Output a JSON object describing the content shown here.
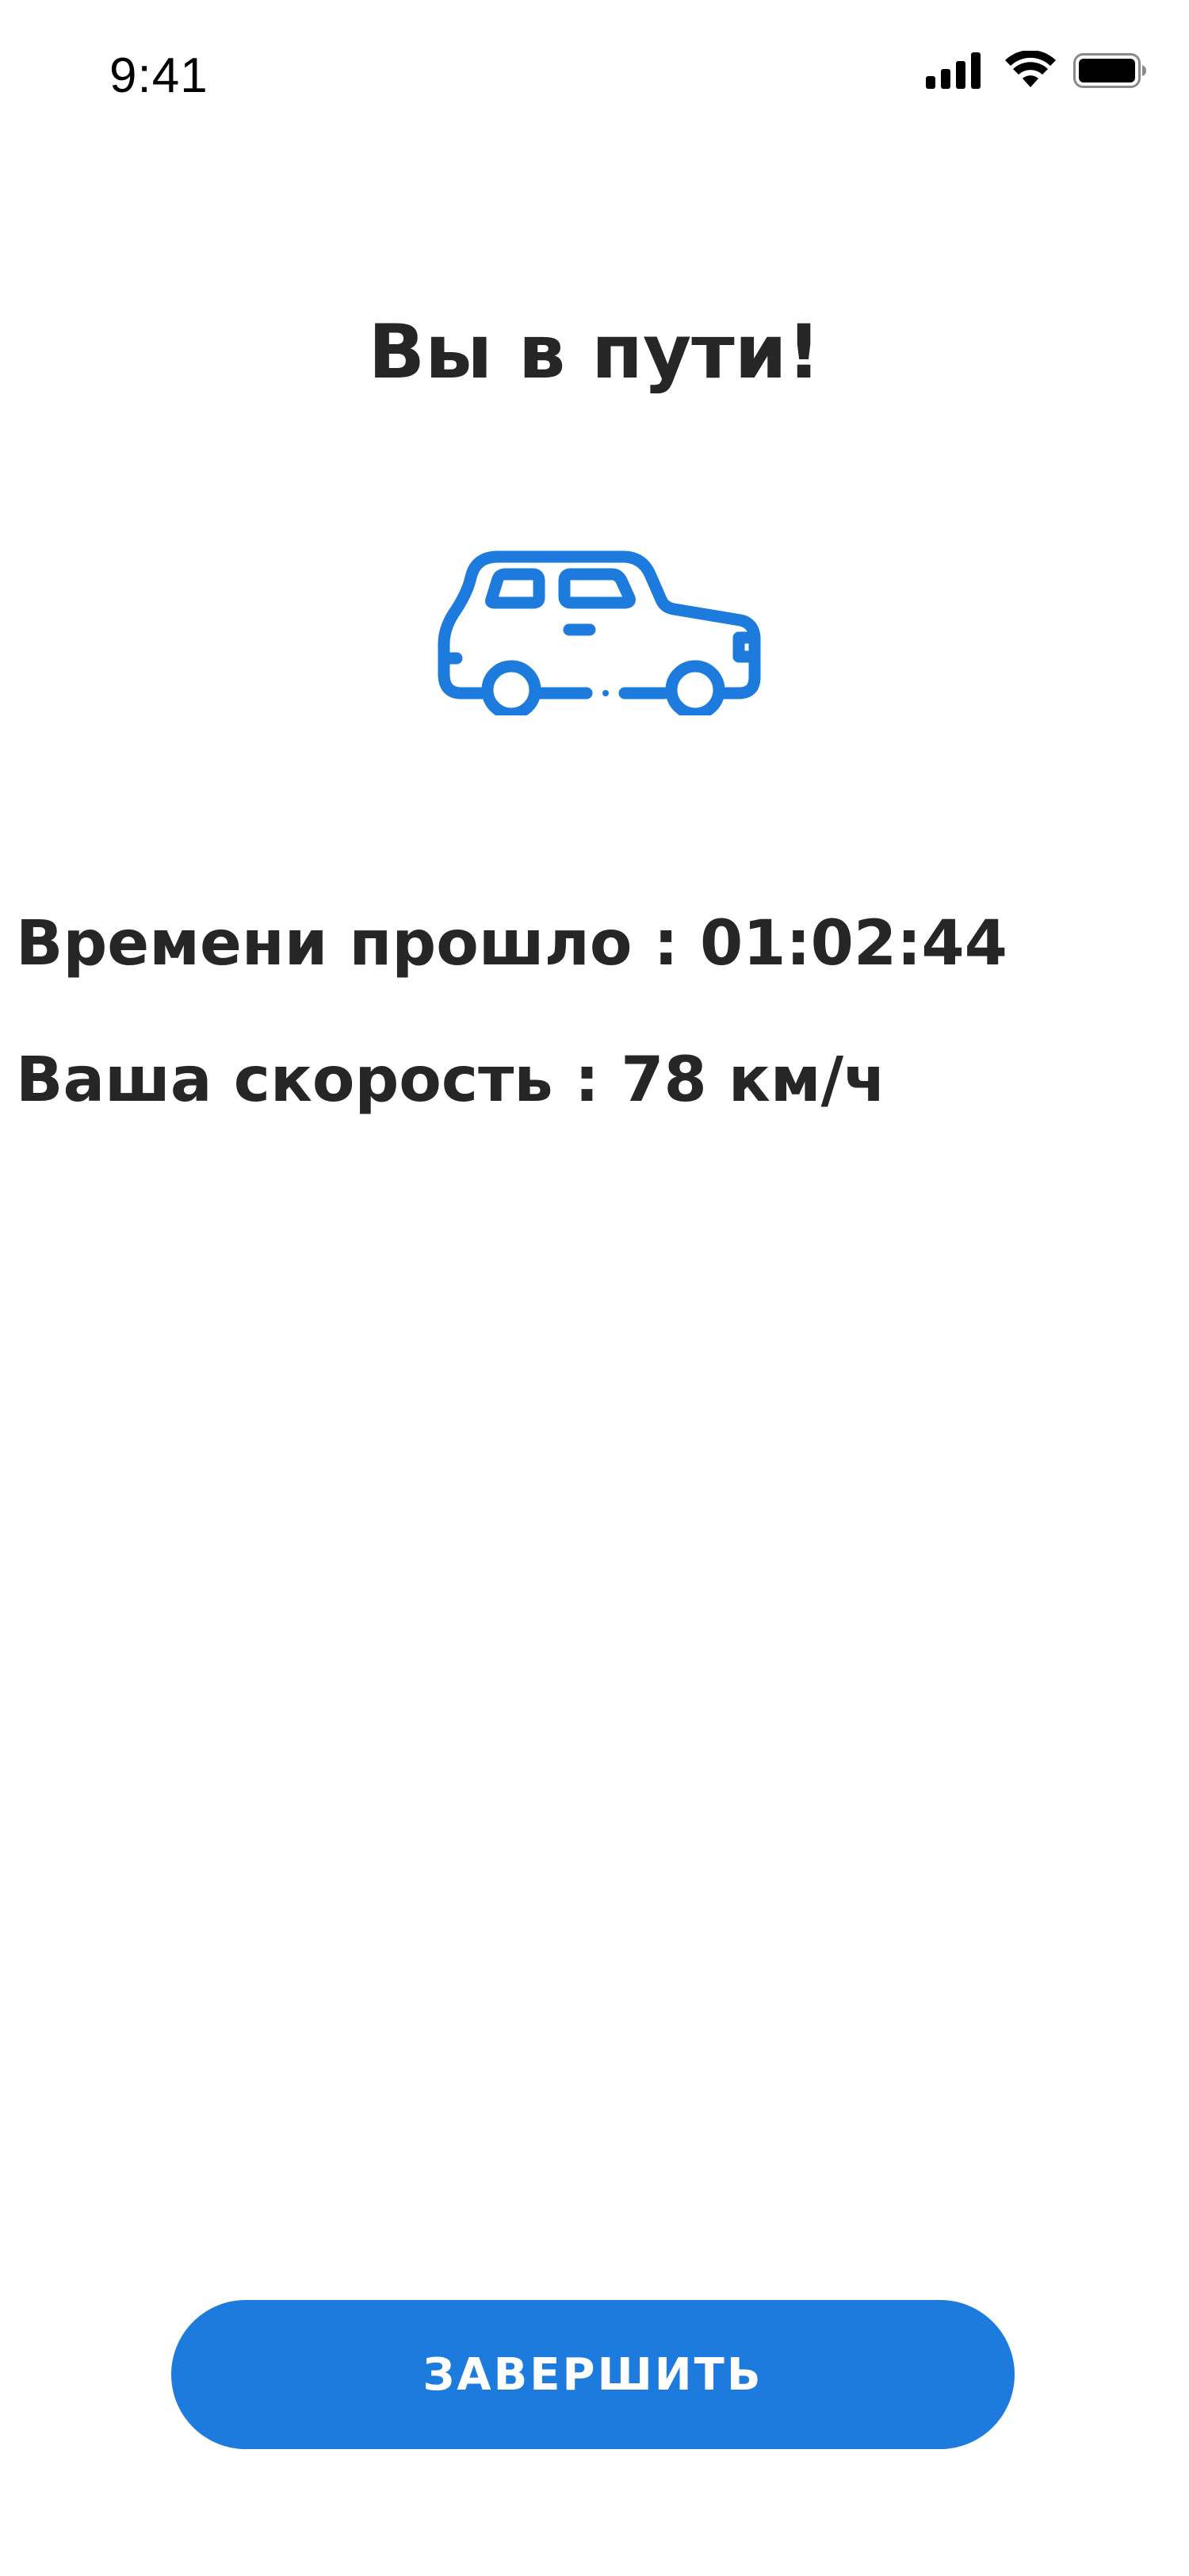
{
  "status_bar": {
    "time": "9:41",
    "icons": [
      "cellular-signal-icon",
      "wifi-icon",
      "battery-icon"
    ]
  },
  "title": "Вы в пути!",
  "illustration": {
    "icon": "car-icon",
    "color": "#1c7bdd"
  },
  "info": {
    "elapsed_label": "Времени прошло",
    "elapsed_value": "01:02:44",
    "speed_label": "Ваша скорость",
    "speed_value": "78 км/ч",
    "separator": " : "
  },
  "actions": {
    "finish_label": "ЗАВЕРШИТЬ"
  },
  "colors": {
    "accent": "#1c7bdd",
    "text": "#262626",
    "background": "#ffffff"
  }
}
